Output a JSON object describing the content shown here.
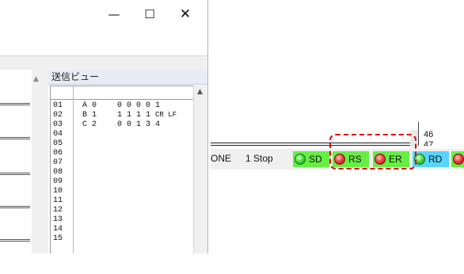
{
  "window": {
    "controls": {
      "minimize": "—",
      "maximize": "☐",
      "close": "✕"
    },
    "scroll_up_icon": "▲"
  },
  "send_view": {
    "title": "送信ビュー",
    "rows": [
      {
        "num": "01",
        "col1": "A 0",
        "col2": "0 0 0 0 1",
        "crlf": ""
      },
      {
        "num": "02",
        "col1": "B 1",
        "col2": "1 1 1 1",
        "crlf": "CR LF"
      },
      {
        "num": "03",
        "col1": "C 2",
        "col2": "0 0 1 3 4",
        "crlf": ""
      },
      {
        "num": "04",
        "col1": "",
        "col2": "",
        "crlf": ""
      },
      {
        "num": "05",
        "col1": "",
        "col2": "",
        "crlf": ""
      },
      {
        "num": "06",
        "col1": "",
        "col2": "",
        "crlf": ""
      },
      {
        "num": "07",
        "col1": "",
        "col2": "",
        "crlf": ""
      },
      {
        "num": "08",
        "col1": "",
        "col2": "",
        "crlf": ""
      },
      {
        "num": "09",
        "col1": "",
        "col2": "",
        "crlf": ""
      },
      {
        "num": "10",
        "col1": "",
        "col2": "",
        "crlf": ""
      },
      {
        "num": "11",
        "col1": "",
        "col2": "",
        "crlf": ""
      },
      {
        "num": "12",
        "col1": "",
        "col2": "",
        "crlf": ""
      },
      {
        "num": "13",
        "col1": "",
        "col2": "",
        "crlf": ""
      },
      {
        "num": "14",
        "col1": "",
        "col2": "",
        "crlf": ""
      },
      {
        "num": "15",
        "col1": "",
        "col2": "",
        "crlf": ""
      }
    ]
  },
  "status": {
    "line_numbers": [
      "46",
      "47"
    ],
    "parity": "ONE",
    "stop_bits": "1 Stop",
    "indicators": [
      {
        "label": "SD",
        "led": "green",
        "bg": "#66ee44"
      },
      {
        "label": "RS",
        "led": "red",
        "bg": "#66ee44"
      },
      {
        "label": "ER",
        "led": "red",
        "bg": "#66ee44"
      },
      {
        "label": "RD",
        "led": "green",
        "bg": "#55d5ff"
      },
      {
        "label": "",
        "led": "red",
        "bg": "#66ee44"
      }
    ],
    "highlight_color": "#e00000"
  }
}
